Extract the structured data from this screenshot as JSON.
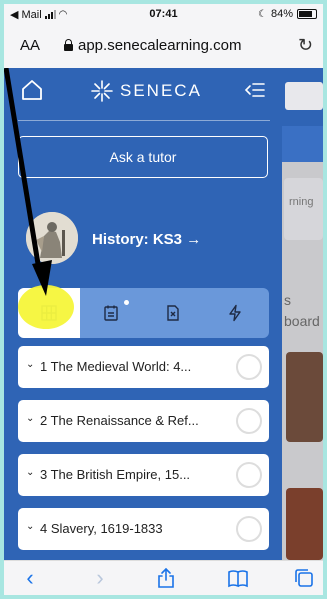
{
  "status": {
    "carrier": "Mail",
    "time": "07:41",
    "battery": "84%"
  },
  "browser": {
    "text_size_label": "AA",
    "url": "app.senecalearning.com"
  },
  "sidebar": {
    "brand": "SENECA",
    "ask_tutor": "Ask a tutor",
    "course_title": "History: KS3 →"
  },
  "items": [
    {
      "label": "1 The Medieval World: 4..."
    },
    {
      "label": "2 The Renaissance & Ref..."
    },
    {
      "label": "3 The British Empire, 15..."
    },
    {
      "label": "4 Slavery, 1619-1833"
    }
  ],
  "background": {
    "card_text": "rning",
    "side_text_1": "s",
    "side_text_2": "board"
  },
  "colors": {
    "sidebar": "#2f64b5",
    "tabs": "#6a98da",
    "highlight": "#f5f53a",
    "link_blue": "#1a73e8"
  }
}
